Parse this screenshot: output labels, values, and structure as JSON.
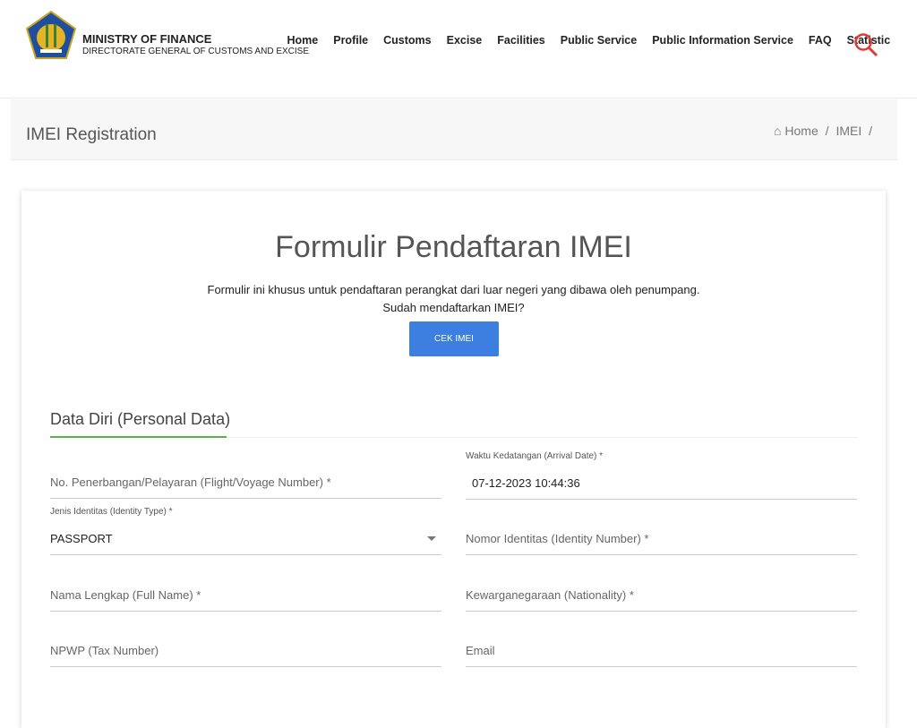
{
  "header": {
    "brand_line1": "MINISTRY OF FINANCE",
    "brand_line2": "DIRECTORATE GENERAL OF CUSTOMS AND EXCISE",
    "nav": [
      "Home",
      "Profile",
      "Customs",
      "Excise",
      "Facilities",
      "Public Service",
      "Public Information Service",
      "FAQ",
      "Statistic"
    ]
  },
  "breadcrumb": {
    "page_title": "IMEI Registration",
    "items": [
      "Home",
      "IMEI"
    ]
  },
  "form": {
    "title": "Formulir Pendaftaran IMEI",
    "subtitle": "Formulir ini khusus untuk pendaftaran perangkat dari luar negeri yang dibawa oleh penumpang.",
    "question": "Sudah mendaftarkan IMEI?",
    "check_button": "CEK IMEI",
    "section": "Data Diri (Personal Data)",
    "flight": "No. Penerbangan/Pelayaran (Flight/Voyage Number) *",
    "arrival_label": "Waktu Kedatangan (Arrival Date) *",
    "arrival_value": "07-12-2023  10:44:36",
    "id_type_label": "Jenis Identitas (Identity Type) *",
    "id_type_value": "PASSPORT",
    "id_number": "Nomor Identitas (Identity Number) *",
    "full_name": "Nama Lengkap (Full Name) *",
    "nationality": "Kewarganegaraan (Nationality) *",
    "npwp": "NPWP (Tax Number)",
    "email": "Email"
  },
  "colors": {
    "button": "#3d7fe0",
    "accent": "#5ab04a",
    "search": "#e53935"
  }
}
